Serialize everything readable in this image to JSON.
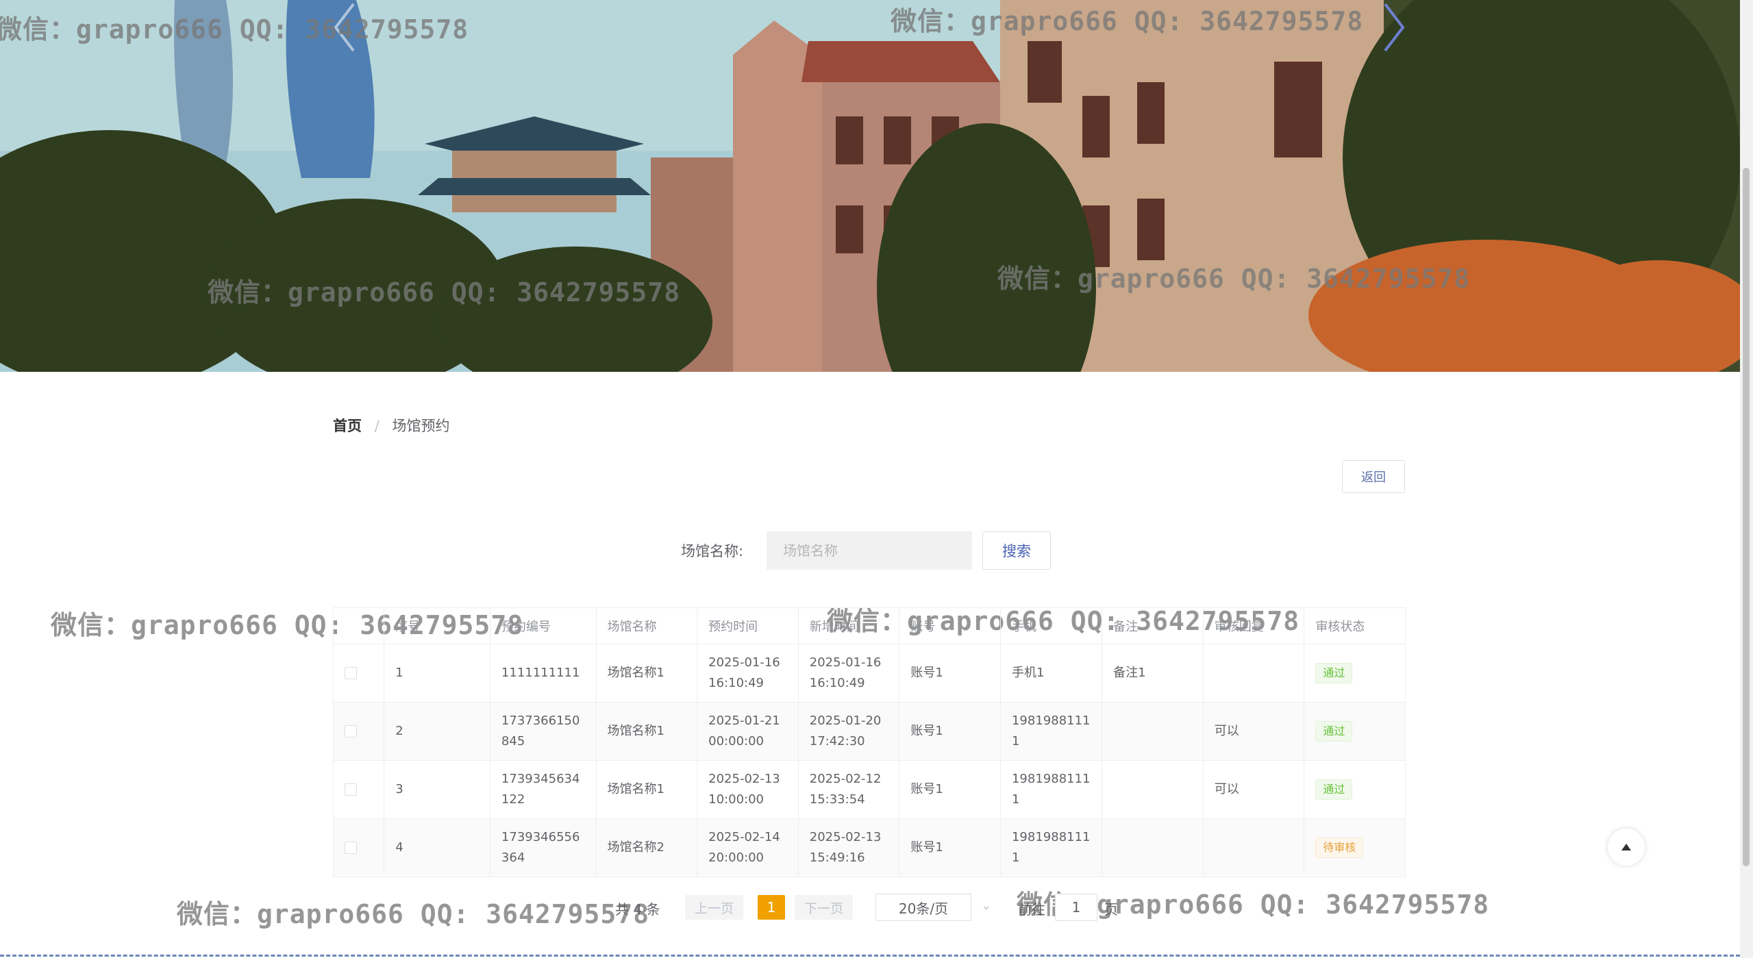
{
  "watermark": "微信：grapro666 QQ: 3642795578",
  "breadcrumb": {
    "home": "首页",
    "separator": "/",
    "current": "场馆预约"
  },
  "back_button": "返回",
  "search": {
    "label": "场馆名称:",
    "placeholder": "场馆名称",
    "button": "搜索"
  },
  "table": {
    "headers": [
      "序号",
      "预约编号",
      "场馆名称",
      "预约时间",
      "新增时间",
      "账号",
      "手机",
      "备注",
      "审核回复",
      "审核状态"
    ],
    "rows": [
      {
        "index": "1",
        "code_a": "1111111111",
        "code_b": "",
        "venue": "场馆名称1",
        "time_a": "2025-01-16",
        "time_b": "16:10:49",
        "created_a": "2025-01-16",
        "created_b": "16:10:49",
        "account": "账号1",
        "phone_a": "手机1",
        "phone_b": "",
        "note": "备注1",
        "reply": "",
        "status": "通过",
        "status_type": "pass"
      },
      {
        "index": "2",
        "code_a": "1737366150",
        "code_b": "845",
        "venue": "场馆名称1",
        "time_a": "2025-01-21",
        "time_b": "00:00:00",
        "created_a": "2025-01-20",
        "created_b": "17:42:30",
        "account": "账号1",
        "phone_a": "1981988111",
        "phone_b": "1",
        "note": "",
        "reply": "可以",
        "status": "通过",
        "status_type": "pass"
      },
      {
        "index": "3",
        "code_a": "1739345634",
        "code_b": "122",
        "venue": "场馆名称1",
        "time_a": "2025-02-13",
        "time_b": "10:00:00",
        "created_a": "2025-02-12",
        "created_b": "15:33:54",
        "account": "账号1",
        "phone_a": "1981988111",
        "phone_b": "1",
        "note": "",
        "reply": "可以",
        "status": "通过",
        "status_type": "pass"
      },
      {
        "index": "4",
        "code_a": "1739346556",
        "code_b": "364",
        "venue": "场馆名称2",
        "time_a": "2025-02-14",
        "time_b": "20:00:00",
        "created_a": "2025-02-13",
        "created_b": "15:49:16",
        "account": "账号1",
        "phone_a": "1981988111",
        "phone_b": "1",
        "note": "",
        "reply": "",
        "status": "待审核",
        "status_type": "pending"
      }
    ]
  },
  "pagination": {
    "total": "共 4 条",
    "prev": "上一页",
    "current": "1",
    "next": "下一页",
    "page_size": "20条/页",
    "goto_prefix": "前往",
    "goto_value": "1",
    "goto_suffix": "页"
  },
  "colors": {
    "accent": "#f0a000",
    "link": "#4a63b3",
    "pass": "#67c23a",
    "pending": "#e6a23c"
  }
}
